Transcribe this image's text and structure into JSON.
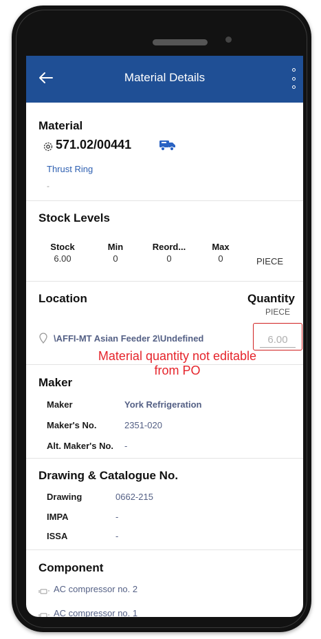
{
  "appbar": {
    "title": "Material Details",
    "back_icon": "arrow-left-icon",
    "menu_icon": "more-vert-icon",
    "color": "#1f4f95"
  },
  "material": {
    "heading": "Material",
    "code": "571.02/00441",
    "name": "Thrust Ring",
    "description": "-"
  },
  "stock": {
    "heading": "Stock Levels",
    "columns": [
      {
        "label": "Stock",
        "value": "6.00"
      },
      {
        "label": "Min",
        "value": "0"
      },
      {
        "label": "Reord...",
        "value": "0"
      },
      {
        "label": "Max",
        "value": "0"
      }
    ],
    "unit": "PIECE"
  },
  "location": {
    "heading": "Location",
    "quantity_heading": "Quantity",
    "quantity_unit": "PIECE",
    "path": "\\AFFI-MT Asian Feeder 2\\Undefined",
    "quantity_value": "6.00",
    "annotation": "Material quantity not editable from PO"
  },
  "maker": {
    "heading": "Maker",
    "rows": [
      {
        "label": "Maker",
        "value": "York Refrigeration"
      },
      {
        "label": "Maker's No.",
        "value": "2351-020"
      },
      {
        "label": "Alt. Maker's No.",
        "value": "-"
      }
    ]
  },
  "drawing": {
    "heading": "Drawing & Catalogue No.",
    "rows": [
      {
        "label": "Drawing",
        "value": "0662-215"
      },
      {
        "label": "IMPA",
        "value": "-"
      },
      {
        "label": "ISSA",
        "value": "-"
      }
    ]
  },
  "component": {
    "heading": "Component",
    "items": [
      {
        "label": "AC compressor no. 2"
      },
      {
        "label": "AC compressor no. 1"
      }
    ]
  }
}
